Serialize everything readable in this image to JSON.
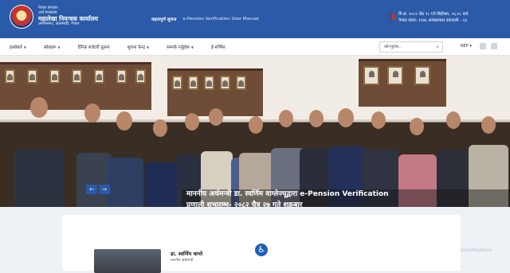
{
  "header": {
    "org_line1": "नेपाल सरकार",
    "org_line2": "अर्थ मन्त्रालय",
    "org_title": "महालेखा नियन्त्रक कार्यालय",
    "org_address": "अनामनगर, काठमाडौं, नेपाल",
    "notice_tag": "महत्वपूर्ण सूचना",
    "notice_link": "e-Pension Verification User Manual",
    "date_line": "मि.सं. २०८२ जेठ १८ गते बिहीबार, ०६:०८ बजे",
    "nepal_era": "नेपाल संवत: ११४६ आषाढमास एकादशी - २३"
  },
  "nav": {
    "items": [
      {
        "label": "हाम्रोबारे",
        "dropdown": true
      },
      {
        "label": "स्रोतहरू",
        "dropdown": true
      },
      {
        "label": "दैनिक बजेटरी तुलना",
        "dropdown": false
      },
      {
        "label": "सूचना केन्द्र",
        "dropdown": true
      },
      {
        "label": "सम्पर्क गर्नुहोस",
        "dropdown": true
      },
      {
        "label": "ई-सर्भिस",
        "dropdown": false
      }
    ],
    "search_placeholder": "खोज्नुहोस..",
    "language": "NEP"
  },
  "hero": {
    "caption_line1": "माननीय अर्थमन्त्री डा. स्वर्णिम वाग्लेज्यूद्वारा e-Pension Verification",
    "caption_line2": "प्रणाली शुभारम्भ- २०८२ चैत्र २७ गते शुक्रबार",
    "prev_label": "←",
    "next_label": "→"
  },
  "profile": {
    "name": "डा. स्वर्णिम वाग्ले",
    "role": "माननीय अर्थमन्त्री"
  },
  "watermark": "ScanMalware",
  "icons": [
    "emblem-icon",
    "flag-icon",
    "search-icon",
    "facebook-icon",
    "twitter-icon",
    "accessibility-icon"
  ],
  "colors": {
    "brand": "#2a5aa8",
    "accessibility": "#1f5fb8"
  }
}
